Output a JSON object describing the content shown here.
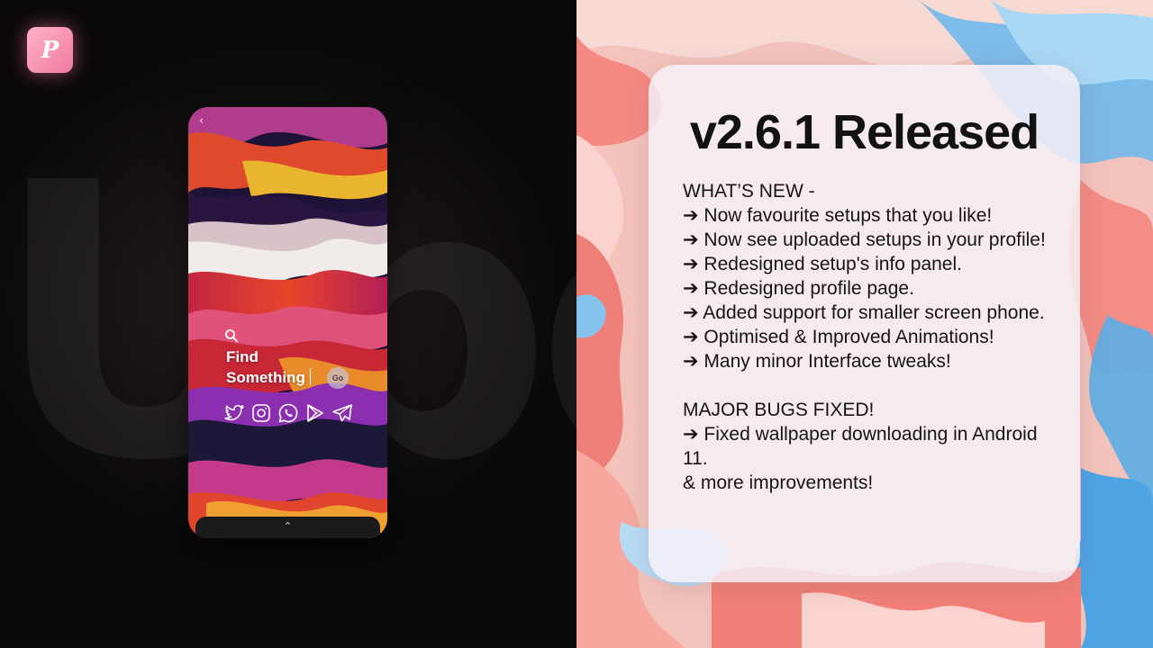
{
  "background_word": "Upd",
  "logo": {
    "letter": "P"
  },
  "phone": {
    "back_glyph": "‹",
    "search": {
      "line1": "Find",
      "line2": "Something",
      "go_label": "Go"
    },
    "socials": [
      "twitter-icon",
      "instagram-icon",
      "whatsapp-icon",
      "play-store-icon",
      "telegram-icon"
    ],
    "bottom_handle_glyph": "⌃"
  },
  "release": {
    "title": "v2.6.1 Released",
    "whats_new_heading": "WHAT’S NEW -",
    "whats_new": [
      "➔ Now favourite setups that you like!",
      "➔ Now see uploaded setups in your profile!",
      "➔ Redesigned setup's info panel.",
      "➔ Redesigned profile page.",
      "➔ Added support for smaller screen phone.",
      "➔ Optimised & Improved Animations!",
      "➔ Many minor Interface tweaks!"
    ],
    "bugs_heading": "MAJOR BUGS FIXED!",
    "bugs_fixed": [
      "➔ Fixed wallpaper downloading in Android 11."
    ],
    "footer": "& more improvements!"
  },
  "colors": {
    "logo_gradient_start": "#ffb2c8",
    "logo_gradient_end": "#f07aa0",
    "card_bg": "#f4f0f6",
    "text": "#151515",
    "marble_pink": "#f6877f",
    "marble_blue": "#4fa8e8"
  }
}
